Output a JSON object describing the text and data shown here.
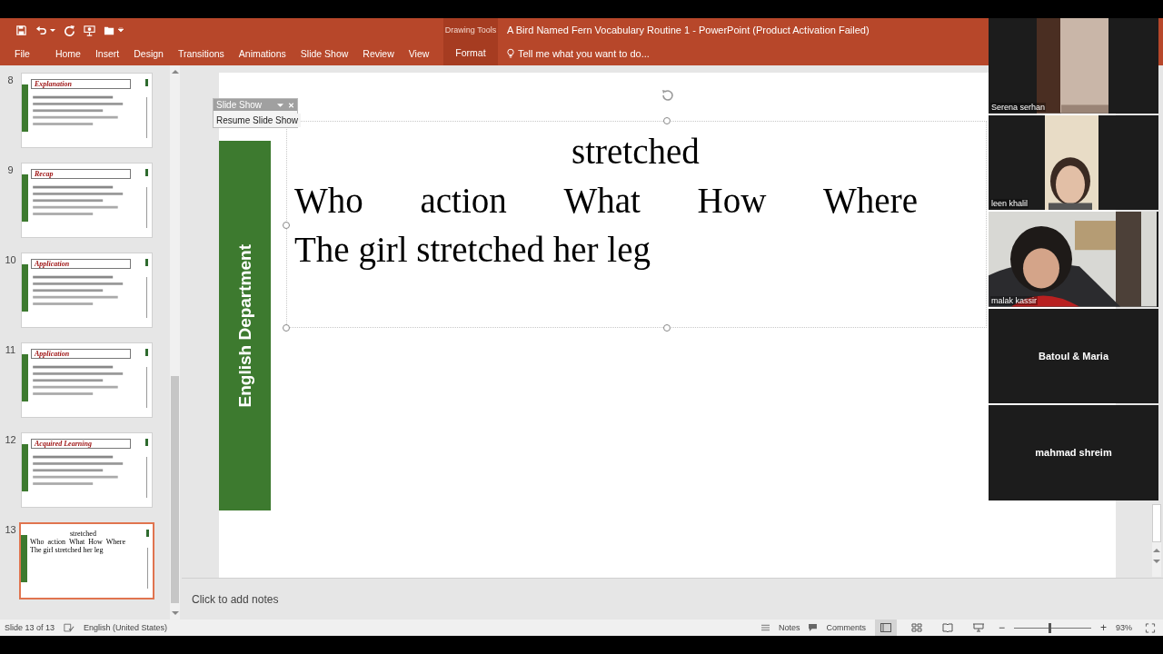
{
  "ribbon": {
    "context_label": "Drawing Tools",
    "title": "A Bird Named Fern Vocabulary Routine 1 - PowerPoint (Product Activation Failed)",
    "tell_me": "Tell me what you want to do...",
    "tabs": [
      {
        "label": "File",
        "selected": false
      },
      {
        "label": "Home",
        "selected": false
      },
      {
        "label": "Insert",
        "selected": false
      },
      {
        "label": "Design",
        "selected": false
      },
      {
        "label": "Transitions",
        "selected": false
      },
      {
        "label": "Animations",
        "selected": false
      },
      {
        "label": "Slide Show",
        "selected": false
      },
      {
        "label": "Review",
        "selected": false
      },
      {
        "label": "View",
        "selected": false
      },
      {
        "label": "Format",
        "selected": true
      }
    ]
  },
  "thumbnails": [
    {
      "number": "8",
      "title": "Explanation",
      "selected": false
    },
    {
      "number": "9",
      "title": "Recap",
      "selected": false
    },
    {
      "number": "10",
      "title": "Application",
      "selected": false
    },
    {
      "number": "11",
      "title": "Application",
      "selected": false
    },
    {
      "number": "12",
      "title": "Acquired  Learning",
      "selected": false
    },
    {
      "number": "13",
      "selected": true,
      "lines": [
        "stretched",
        "Who  action  What  How  Where",
        "The girl stretched her leg"
      ]
    }
  ],
  "slide": {
    "side_label": "English Department",
    "title": "stretched",
    "headers": [
      "Who",
      "action",
      "What",
      "How",
      "Where"
    ],
    "sentence": "The girl stretched her leg"
  },
  "slideshow_toolbar": {
    "title": "Slide Show",
    "button": "Resume Slide Show"
  },
  "notes_placeholder": "Click to add notes",
  "participants": [
    {
      "name": "Serena serhan",
      "kind": "video"
    },
    {
      "name": "leen khalil",
      "kind": "video"
    },
    {
      "name": "malak kassir",
      "kind": "video"
    },
    {
      "name": "Batoul & Maria",
      "kind": "name_only"
    },
    {
      "name": "mahmad shreim",
      "kind": "name_only"
    }
  ],
  "status_bar": {
    "slide_count": "Slide 13 of 13",
    "language": "English (United States)",
    "notes": "Notes",
    "comments": "Comments",
    "zoom": {
      "minus": "−",
      "plus": "+",
      "level": 0.46,
      "reading": "93%"
    }
  }
}
